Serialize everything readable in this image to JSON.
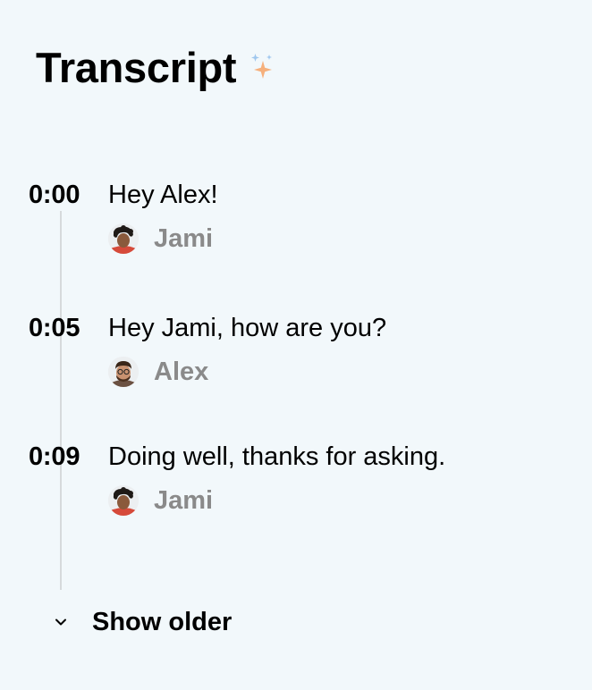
{
  "header": {
    "title": "Transcript",
    "icon": "sparkle-icon"
  },
  "transcript": {
    "entries": [
      {
        "time": "0:00",
        "text": "Hey Alex!",
        "speaker": "Jami",
        "avatar": "avatar-jami"
      },
      {
        "time": "0:05",
        "text": "Hey Jami, how are you?",
        "speaker": "Alex",
        "avatar": "avatar-alex"
      },
      {
        "time": "0:09",
        "text": "Doing well, thanks for asking.",
        "speaker": "Jami",
        "avatar": "avatar-jami"
      }
    ],
    "show_older_label": "Show older",
    "show_older_icon": "chevron-down-icon"
  },
  "colors": {
    "background": "#f2f8fb",
    "speaker_text": "#8a8a8a",
    "timeline": "#d6dadc",
    "sparkle_blue": "#9ec6ee",
    "sparkle_orange": "#f6b07c"
  }
}
